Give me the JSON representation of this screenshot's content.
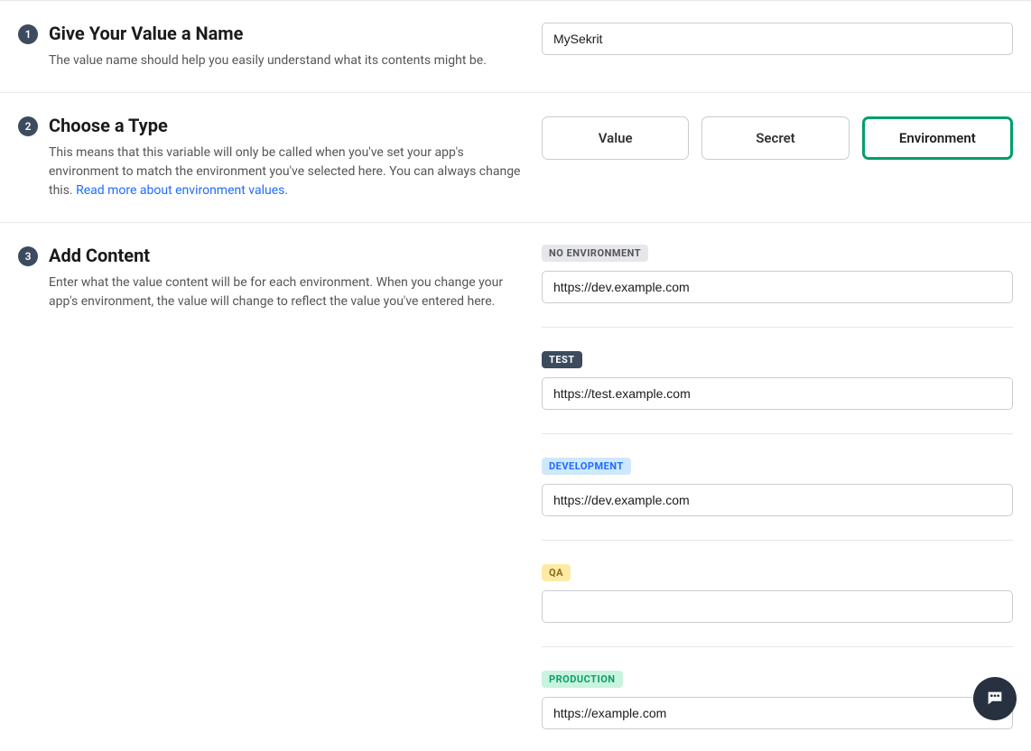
{
  "step1": {
    "num": "1",
    "title": "Give Your Value a Name",
    "desc": "The value name should help you easily understand what its contents might be.",
    "value": "MySekrit"
  },
  "step2": {
    "num": "2",
    "title": "Choose a Type",
    "desc_a": "This means that this variable will only be called when you've set your app's environment to match the environment you've selected here. You can always change this. ",
    "link": "Read more about environment values",
    "types": {
      "value": "Value",
      "secret": "Secret",
      "environment": "Environment"
    },
    "selected": "environment"
  },
  "step3": {
    "num": "3",
    "title": "Add Content",
    "desc": "Enter what the value content will be for each environment. When you change your app's environment, the value will change to reflect the value you've entered here.",
    "envs": [
      {
        "tag": "NO ENVIRONMENT",
        "tagClass": "tag-gray",
        "value": "https://dev.example.com"
      },
      {
        "tag": "TEST",
        "tagClass": "tag-dark",
        "value": "https://test.example.com"
      },
      {
        "tag": "DEVELOPMENT",
        "tagClass": "tag-blue",
        "value": "https://dev.example.com"
      },
      {
        "tag": "QA",
        "tagClass": "tag-yellow",
        "value": ""
      },
      {
        "tag": "PRODUCTION",
        "tagClass": "tag-green",
        "value": "https://example.com"
      }
    ]
  }
}
